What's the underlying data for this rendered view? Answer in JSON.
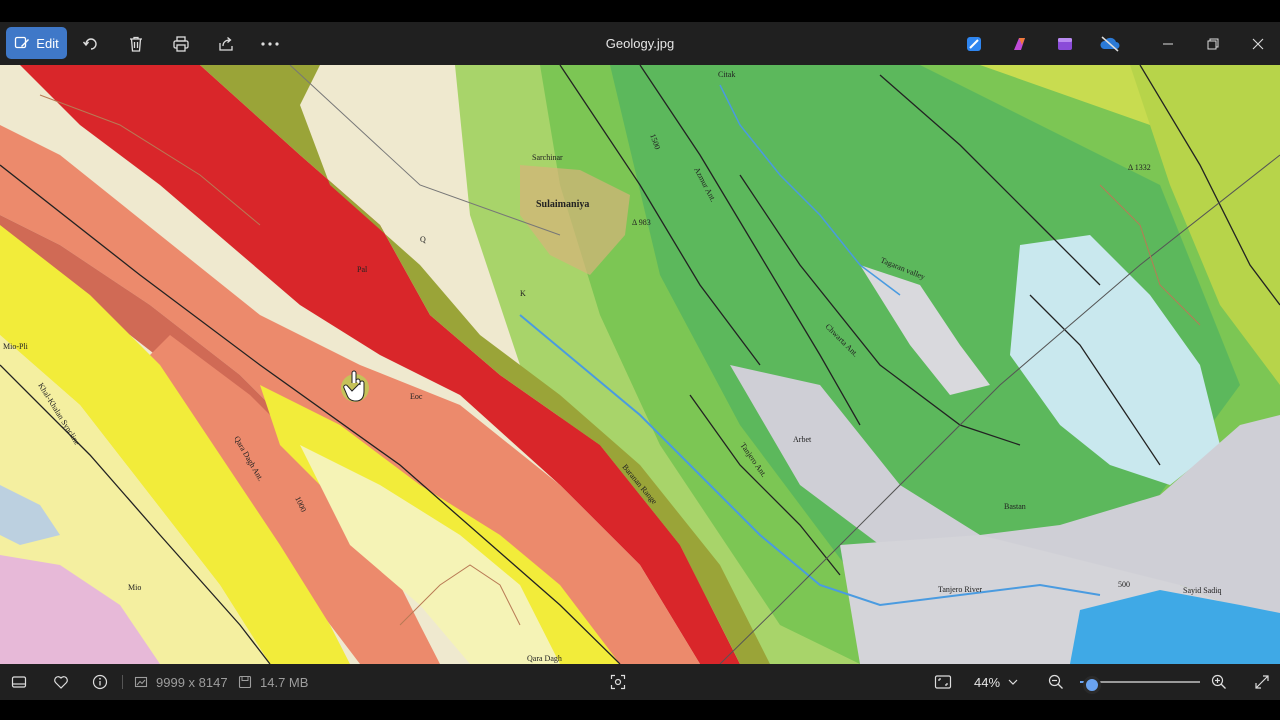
{
  "toolbar": {
    "edit_label": "Edit",
    "file_title": "Geology.jpg"
  },
  "map_labels": {
    "sulaimaniya": "Sulaimaniya",
    "sarchinar": "Sarchinar",
    "citak": "Citak",
    "arbet": "Arbet",
    "bastan": "Bastan",
    "sayid_sadiq": "Sayid Sadiq",
    "qara_dagh": "Qara Dagh",
    "tanjero_river": "Tanjero River",
    "tanjero_ant": "Tanjero Ant.",
    "chwarta_ant": "Chwarta Ant.",
    "azmur_ant": "Azmur Ant.",
    "tagaran_valley": "Tagaran valley",
    "baranan_range": "Baranan Range",
    "qara_dagh_ant": "Qara Dagh Ant.",
    "khal_khalan_syncline": "Khal-Khalan Syncline",
    "mio_pli": "Mio-Pli",
    "peak_1332": "Δ 1332",
    "peak_983": "Δ 983",
    "contour_1000": "1000",
    "contour_1500": "1500",
    "contour_500": "500",
    "unit_pal": "Pal",
    "unit_q": "Q",
    "unit_eoc": "Eoc",
    "unit_k": "K",
    "unit_mio": "Mio"
  },
  "status": {
    "dimensions": "9999 x 8147",
    "file_size": "14.7 MB",
    "zoom": "44%",
    "zoom_fraction": 0.1
  },
  "colors": {
    "accent": "#3f78c8",
    "slider": "#6aa3f0"
  }
}
